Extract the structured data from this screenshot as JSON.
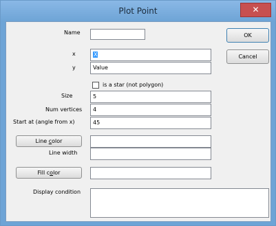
{
  "window": {
    "title": "Plot Point",
    "close_glyph": "✕"
  },
  "buttons": {
    "ok": "OK",
    "cancel": "Cancel"
  },
  "fields": {
    "name": {
      "label": "Name",
      "value": ""
    },
    "x": {
      "label": "x",
      "value": "X"
    },
    "y": {
      "label": "y",
      "value": "Value"
    },
    "is_star": {
      "label": "is a star (not polygon)",
      "checked": false
    },
    "size": {
      "label": "Size",
      "value": "5"
    },
    "num_vertices": {
      "label": "Num vertices",
      "value": "4"
    },
    "start_at": {
      "label": "Start at (angle from x)",
      "value": "45"
    },
    "line_color": {
      "button_pre": "Line ",
      "button_underlined": "c",
      "button_post": "olor",
      "value": ""
    },
    "line_width": {
      "label": "Line width",
      "value": ""
    },
    "fill_color": {
      "button_pre": "Fill c",
      "button_underlined": "o",
      "button_post": "lor",
      "value": ""
    },
    "display_condition": {
      "label": "Display condition",
      "value": ""
    }
  },
  "colors": {
    "titlebar": "#6ea4d6",
    "close_button": "#c75050",
    "selection": "#3399ff"
  }
}
